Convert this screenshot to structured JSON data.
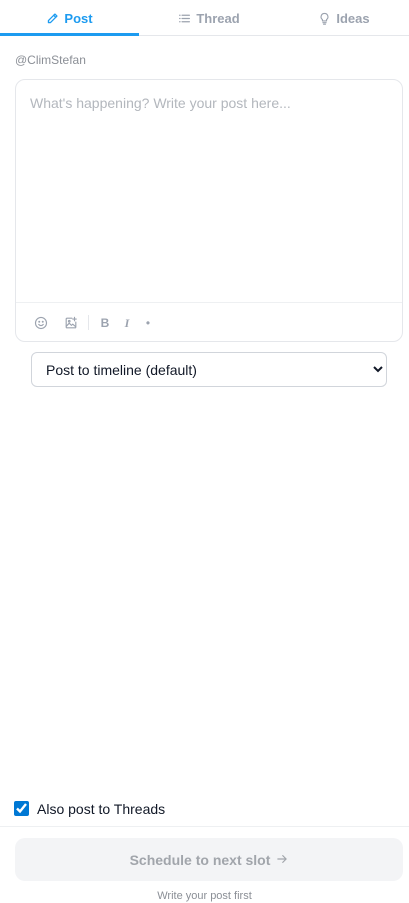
{
  "tabs": [
    {
      "label": "Post",
      "icon": "pencil-icon",
      "active": true
    },
    {
      "label": "Thread",
      "icon": "list-icon",
      "active": false
    },
    {
      "label": "Ideas",
      "icon": "lightbulb-icon",
      "active": false
    }
  ],
  "account": {
    "handle": "@ClimStefan"
  },
  "composer": {
    "placeholder": "What's happening? Write your post here...",
    "value": "",
    "toolbar": {
      "emoji_icon": "smiley-icon",
      "media_icon": "image-add-icon",
      "bold_label": "B",
      "italic_label": "I",
      "bullet_label": "•"
    }
  },
  "destination": {
    "selected": "Post to timeline (default)",
    "options": [
      "Post to timeline (default)"
    ]
  },
  "threads_crosspost": {
    "label": "Also post to Threads",
    "checked": true
  },
  "schedule": {
    "label": "Schedule to next slot",
    "arrow": "→"
  },
  "hint": "Write your post first",
  "colors": {
    "accent": "#1d9bf0",
    "checkbox": "#0078d4",
    "muted": "#9ca3af"
  }
}
